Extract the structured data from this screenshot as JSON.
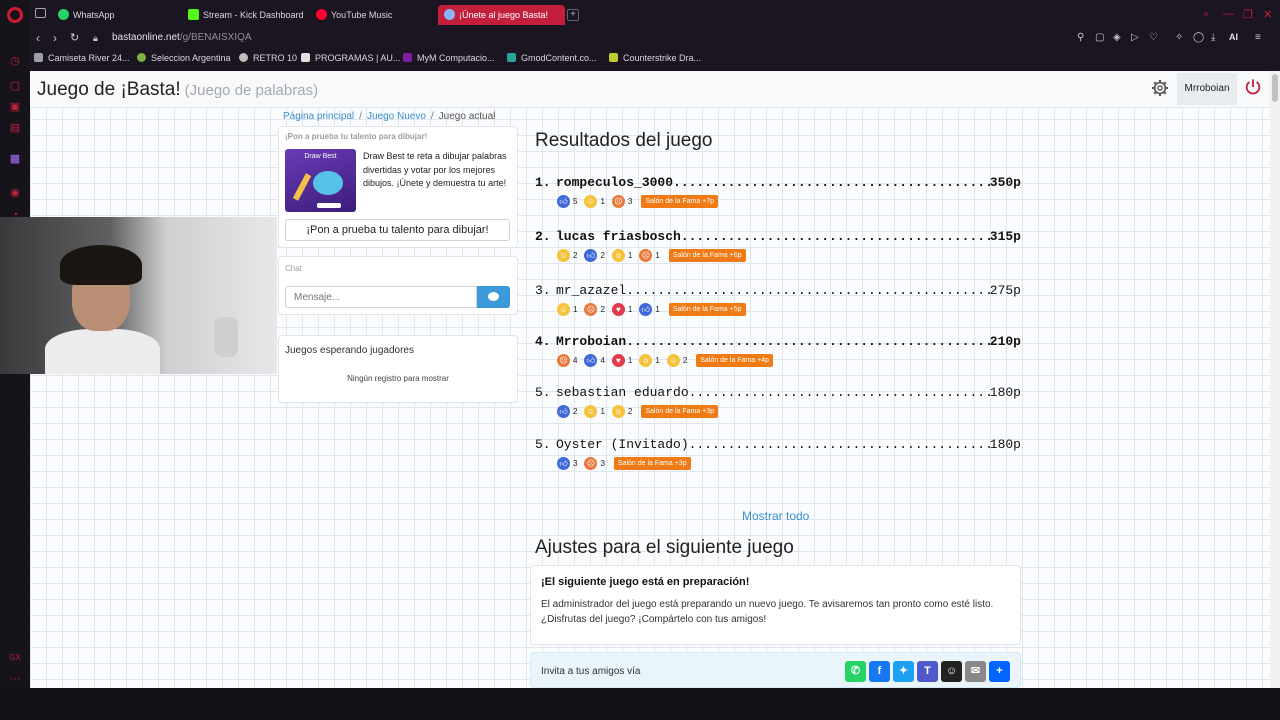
{
  "browser": {
    "tabs": [
      {
        "label": "WhatsApp",
        "color": "#25d366"
      },
      {
        "label": "Stream - Kick Dashboard",
        "color": "#53fc18"
      },
      {
        "label": "YouTube Music",
        "color": "#ff0033"
      },
      {
        "label": "¡Únete al juego Basta!",
        "color": "#8ab4f8"
      }
    ],
    "url_host": "bastaonline.net",
    "url_path": "/g/BENAISXIQA",
    "ai_label": "AI",
    "sidebar_gx": "GX",
    "bookmarks": [
      {
        "label": "Camiseta River 24...",
        "color": "#9aa0a6"
      },
      {
        "label": "Seleccion Argentina",
        "color": "#7cb342"
      },
      {
        "label": "RETRO 10",
        "color": "#bdbdbd"
      },
      {
        "label": "PROGRAMAS | AU...",
        "color": "#e0e0e0"
      },
      {
        "label": "MyM Computacio...",
        "color": "#7b1fa2"
      },
      {
        "label": "GmodContent.co...",
        "color": "#26a69a"
      },
      {
        "label": "Counterstrike Dra...",
        "color": "#c0ca33"
      }
    ]
  },
  "header": {
    "title": "Juego de ¡Basta!",
    "subtitle": "(Juego de palabras)",
    "username": "Mrroboian"
  },
  "breadcrumb": [
    "Página principal",
    "Juego Nuevo",
    "Juego actual"
  ],
  "promo": {
    "heading": "¡Pon a prueba tu talento para dibujar!",
    "image_label": "Draw Best",
    "text": "Draw Best te reta a dibujar palabras divertidas y votar por los mejores dibujos. ¡Únete y demuestra tu arte!",
    "button": "¡Pon a prueba tu talento para dibujar!"
  },
  "chat": {
    "label": "Chat",
    "placeholder": "Mensaje..."
  },
  "waiting": {
    "title": "Juegos esperando jugadores",
    "empty": "Ningún registro para mostrar"
  },
  "results": {
    "title": "Resultados del juego",
    "rows": [
      {
        "rank": "1.",
        "name": "rompeculos_3000",
        "points": "350p",
        "bold": true,
        "badges": [
          {
            "icon": "like",
            "count": "5"
          },
          {
            "icon": "laugh",
            "count": "1"
          },
          {
            "icon": "angry",
            "count": "3"
          }
        ],
        "fame": "Salón de la Fama +7p"
      },
      {
        "rank": "2.",
        "name": "lucas friasbosch",
        "points": "315p",
        "bold": true,
        "badges": [
          {
            "icon": "laugh",
            "count": "2"
          },
          {
            "icon": "like",
            "count": "2"
          },
          {
            "icon": "wow",
            "count": "1"
          },
          {
            "icon": "angry",
            "count": "1"
          }
        ],
        "fame": "Salón de la Fama +6p"
      },
      {
        "rank": "3.",
        "name": "mr_azazel",
        "points": "275p",
        "bold": false,
        "badges": [
          {
            "icon": "laugh",
            "count": "1"
          },
          {
            "icon": "angry",
            "count": "2"
          },
          {
            "icon": "heart",
            "count": "1"
          },
          {
            "icon": "like",
            "count": "1"
          }
        ],
        "fame": "Salón de la Fama +5p"
      },
      {
        "rank": "4.",
        "name": "Mrroboian",
        "points": "210p",
        "bold": true,
        "badges": [
          {
            "icon": "angry",
            "count": "4"
          },
          {
            "icon": "like",
            "count": "4"
          },
          {
            "icon": "heart",
            "count": "1"
          },
          {
            "icon": "wow",
            "count": "1"
          },
          {
            "icon": "laugh",
            "count": "2"
          }
        ],
        "fame": "Salón de la Fama +4p"
      },
      {
        "rank": "5.",
        "name": "sebastian eduardo",
        "points": "180p",
        "bold": false,
        "badges": [
          {
            "icon": "like",
            "count": "2"
          },
          {
            "icon": "laugh",
            "count": "1"
          },
          {
            "icon": "wow",
            "count": "2"
          }
        ],
        "fame": "Salón de la Fama +3p"
      },
      {
        "rank": "5.",
        "name": "Oyster (Invitado)",
        "points": "180p",
        "bold": false,
        "badges": [
          {
            "icon": "like",
            "count": "3"
          },
          {
            "icon": "angry",
            "count": "3"
          }
        ],
        "fame": "Salón de la Fama +3p"
      }
    ],
    "show_all": "Mostrar todo"
  },
  "next_game": {
    "title": "Ajustes para el siguiente juego",
    "card_title": "¡El siguiente juego está en preparación!",
    "card_body": "El administrador del juego está preparando un nuevo juego. Te avisaremos tan pronto como esté listo. ¿Disfrutas del juego? ¡Compártelo con tus amigos!"
  },
  "invite": {
    "label": "Invita a tus amigos vía",
    "share": [
      {
        "name": "whatsapp",
        "color": "#25d366"
      },
      {
        "name": "facebook",
        "color": "#1877f2"
      },
      {
        "name": "twitter",
        "color": "#1da1f2"
      },
      {
        "name": "teams",
        "color": "#5059c9"
      },
      {
        "name": "snapchat",
        "color": "#222222"
      },
      {
        "name": "email",
        "color": "#888888"
      },
      {
        "name": "more",
        "color": "#0166ff"
      }
    ]
  },
  "colors": {
    "accent": "#c31f3c",
    "link": "#3a8fd0",
    "fame_badge": "#f07b14"
  }
}
